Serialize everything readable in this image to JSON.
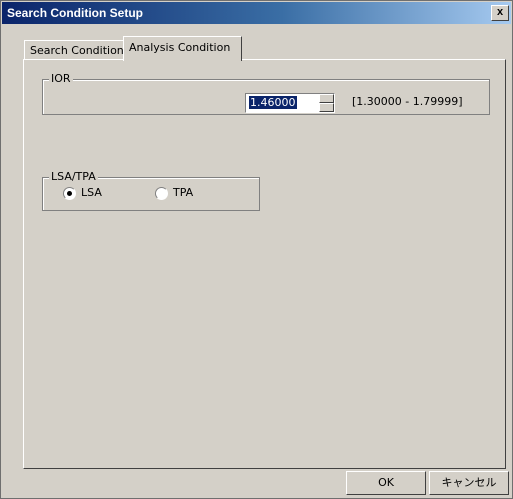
{
  "window": {
    "title": "Search Condition Setup",
    "close_glyph": "x"
  },
  "tabs": [
    {
      "label": "Search Condition",
      "active": false
    },
    {
      "label": "Analysis Condition",
      "active": true
    }
  ],
  "ior": {
    "group_label": "IOR",
    "value": "1.46000",
    "range": "[1.30000 - 1.79999]"
  },
  "lsa_tpa": {
    "group_label": "LSA/TPA",
    "options": [
      {
        "label": "LSA",
        "selected": true
      },
      {
        "label": "TPA",
        "selected": false
      }
    ]
  },
  "buttons": {
    "ok": "OK",
    "cancel": "キャンセル"
  },
  "colors": {
    "titlebar_start": "#0a246a",
    "titlebar_end": "#a6caf0",
    "face": "#d4d0c8",
    "selection": "#0a246a"
  }
}
